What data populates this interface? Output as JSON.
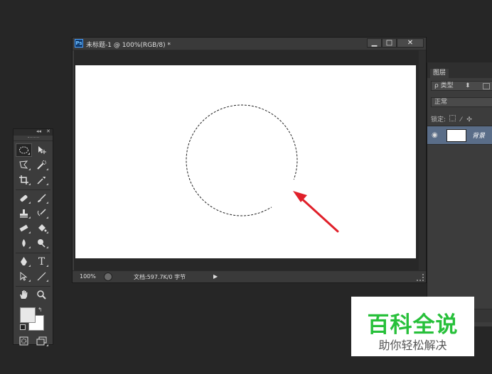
{
  "document": {
    "app_icon_text": "Ps",
    "title": "未标题-1 @ 100%(RGB/8) *",
    "buttons": {
      "minimize": "▁",
      "maximize": "□",
      "close": "✕"
    },
    "status": {
      "zoom": "100%",
      "doc_info": "文档:597.7K/0 字节",
      "arrow": "▶"
    }
  },
  "toolbox": {
    "header": {
      "collapse": "◂◂",
      "close": "✕"
    },
    "text_tool_label": "T"
  },
  "layers_panel": {
    "tab_label": "图层",
    "filter_label": "ρ 类型",
    "blend_mode": "正常",
    "lock_label": "锁定:",
    "layer_name": "背景"
  },
  "watermark": {
    "title": "百科全说",
    "subtitle": "助你轻松解决"
  },
  "colors": {
    "background": "#262626",
    "panel": "#3c3c3c",
    "selected_layer": "#5a6d88",
    "arrow": "#e0202a",
    "watermark_green": "#27c03a"
  }
}
